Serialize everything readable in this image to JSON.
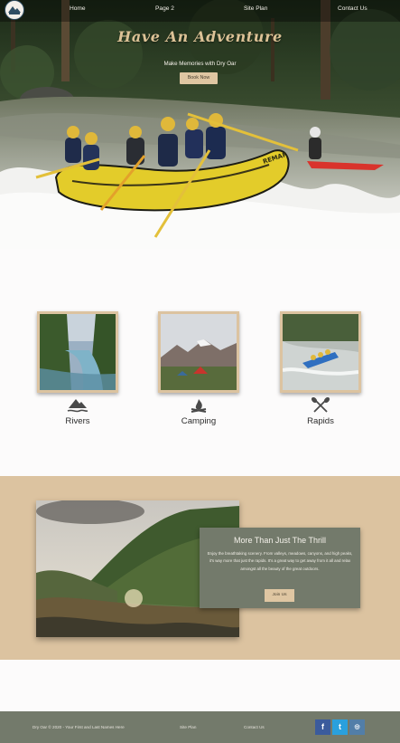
{
  "nav": {
    "links": [
      "Home",
      "Page 2",
      "Site Plan",
      "Contact Us"
    ]
  },
  "hero": {
    "title": "Have An Adventure",
    "subtitle": "Make Memories with Dry Oar",
    "button": "Book Now",
    "raft_text": "REMAR"
  },
  "cards": [
    {
      "label": "Rivers",
      "icon": "mountain-river-icon"
    },
    {
      "label": "Camping",
      "icon": "campfire-icon"
    },
    {
      "label": "Rapids",
      "icon": "crossed-paddles-icon"
    }
  ],
  "thrill": {
    "title": "More Than Just The Thrill",
    "text": "Enjoy the breathtaking scenery. From valleys, meadows, canyons, and high peaks, it's way more that just the rapids. It's a great way to get away from it all and relax amongst all the beauty of the great outdoors.",
    "button": "Join Us"
  },
  "footer": {
    "copyright": "Dry Oar © 2020 - Your First and Last Names Here",
    "links": [
      "Site Plan",
      "Contact Us"
    ],
    "social": [
      {
        "name": "facebook-icon",
        "glyph": "f"
      },
      {
        "name": "twitter-icon",
        "glyph": "t"
      },
      {
        "name": "instagram-icon",
        "glyph": "◎"
      }
    ]
  },
  "colors": {
    "accent": "#dcc3a0",
    "footer": "#737a6b",
    "overlay": "#737a6b",
    "raft": "#e3cc2a"
  }
}
